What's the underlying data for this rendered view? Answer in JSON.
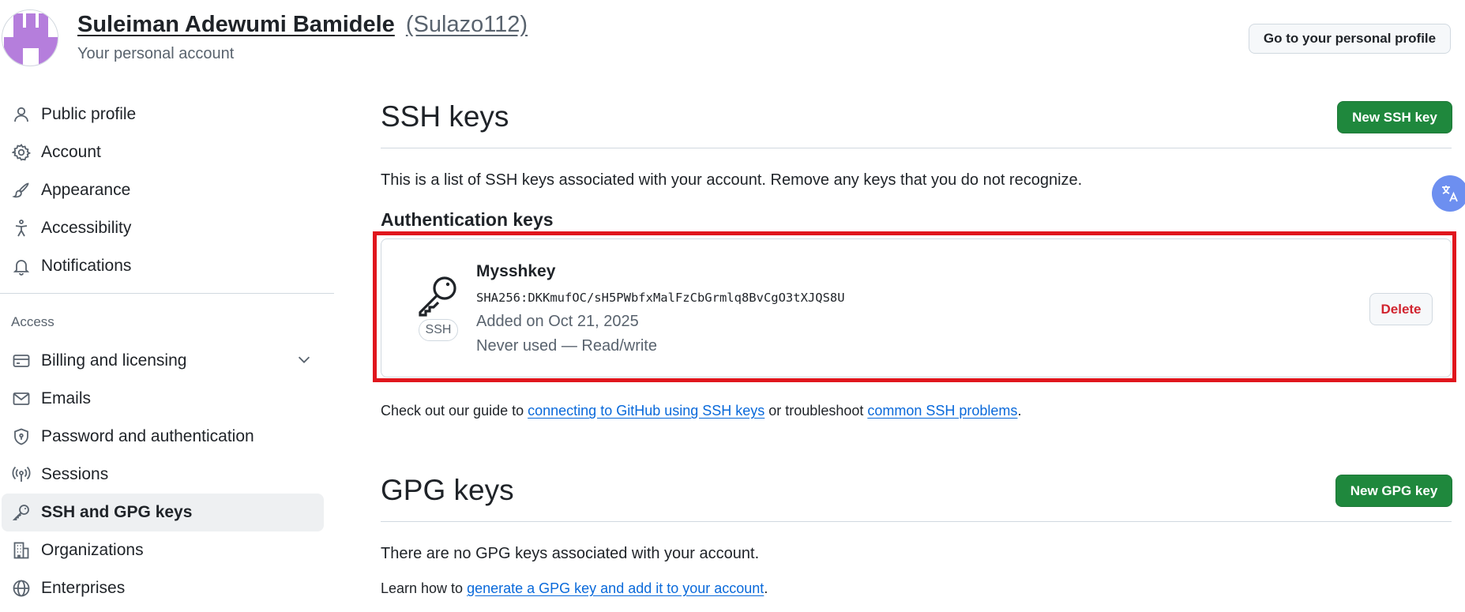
{
  "header": {
    "display_name": "Suleiman Adewumi Bamidele",
    "username": "(Sulazo112)",
    "subtitle": "Your personal account",
    "profile_button": "Go to your personal profile"
  },
  "sidebar": {
    "items": [
      {
        "label": "Public profile",
        "icon": "person-icon"
      },
      {
        "label": "Account",
        "icon": "gear-icon"
      },
      {
        "label": "Appearance",
        "icon": "paintbrush-icon"
      },
      {
        "label": "Accessibility",
        "icon": "accessibility-icon"
      },
      {
        "label": "Notifications",
        "icon": "bell-icon"
      }
    ],
    "access_heading": "Access",
    "access_items": [
      {
        "label": "Billing and licensing",
        "icon": "credit-card-icon"
      },
      {
        "label": "Emails",
        "icon": "mail-icon"
      },
      {
        "label": "Password and authentication",
        "icon": "shield-lock-icon"
      },
      {
        "label": "Sessions",
        "icon": "broadcast-icon"
      },
      {
        "label": "SSH and GPG keys",
        "icon": "key-icon",
        "active": true
      },
      {
        "label": "Organizations",
        "icon": "organization-icon"
      },
      {
        "label": "Enterprises",
        "icon": "globe-icon"
      }
    ]
  },
  "ssh": {
    "title": "SSH keys",
    "new_button": "New SSH key",
    "description": "This is a list of SSH keys associated with your account. Remove any keys that you do not recognize.",
    "auth_heading": "Authentication keys",
    "key": {
      "badge": "SSH",
      "title": "Mysshkey",
      "fingerprint": "SHA256:DKKmufOC/sH5PWbfxMalFzCbGrmlq8BvCgO3tXJQS8U",
      "added": "Added on Oct 21, 2025",
      "usage": "Never used — Read/write",
      "delete_label": "Delete"
    },
    "guide_prefix": "Check out our guide to ",
    "guide_link": "connecting to GitHub using SSH keys",
    "guide_middle": " or troubleshoot ",
    "troubleshoot_link": "common SSH problems",
    "guide_suffix": "."
  },
  "gpg": {
    "title": "GPG keys",
    "new_button": "New GPG key",
    "description": "There are no GPG keys associated with your account.",
    "learn_prefix": "Learn how to ",
    "learn_link": "generate a GPG key and add it to your account",
    "learn_suffix": "."
  },
  "colors": {
    "primary_green": "#1f883d",
    "link_blue": "#0969da",
    "danger_red": "#d1242f",
    "highlight_red": "#e0161d",
    "avatar_purple": "#b57edc"
  }
}
